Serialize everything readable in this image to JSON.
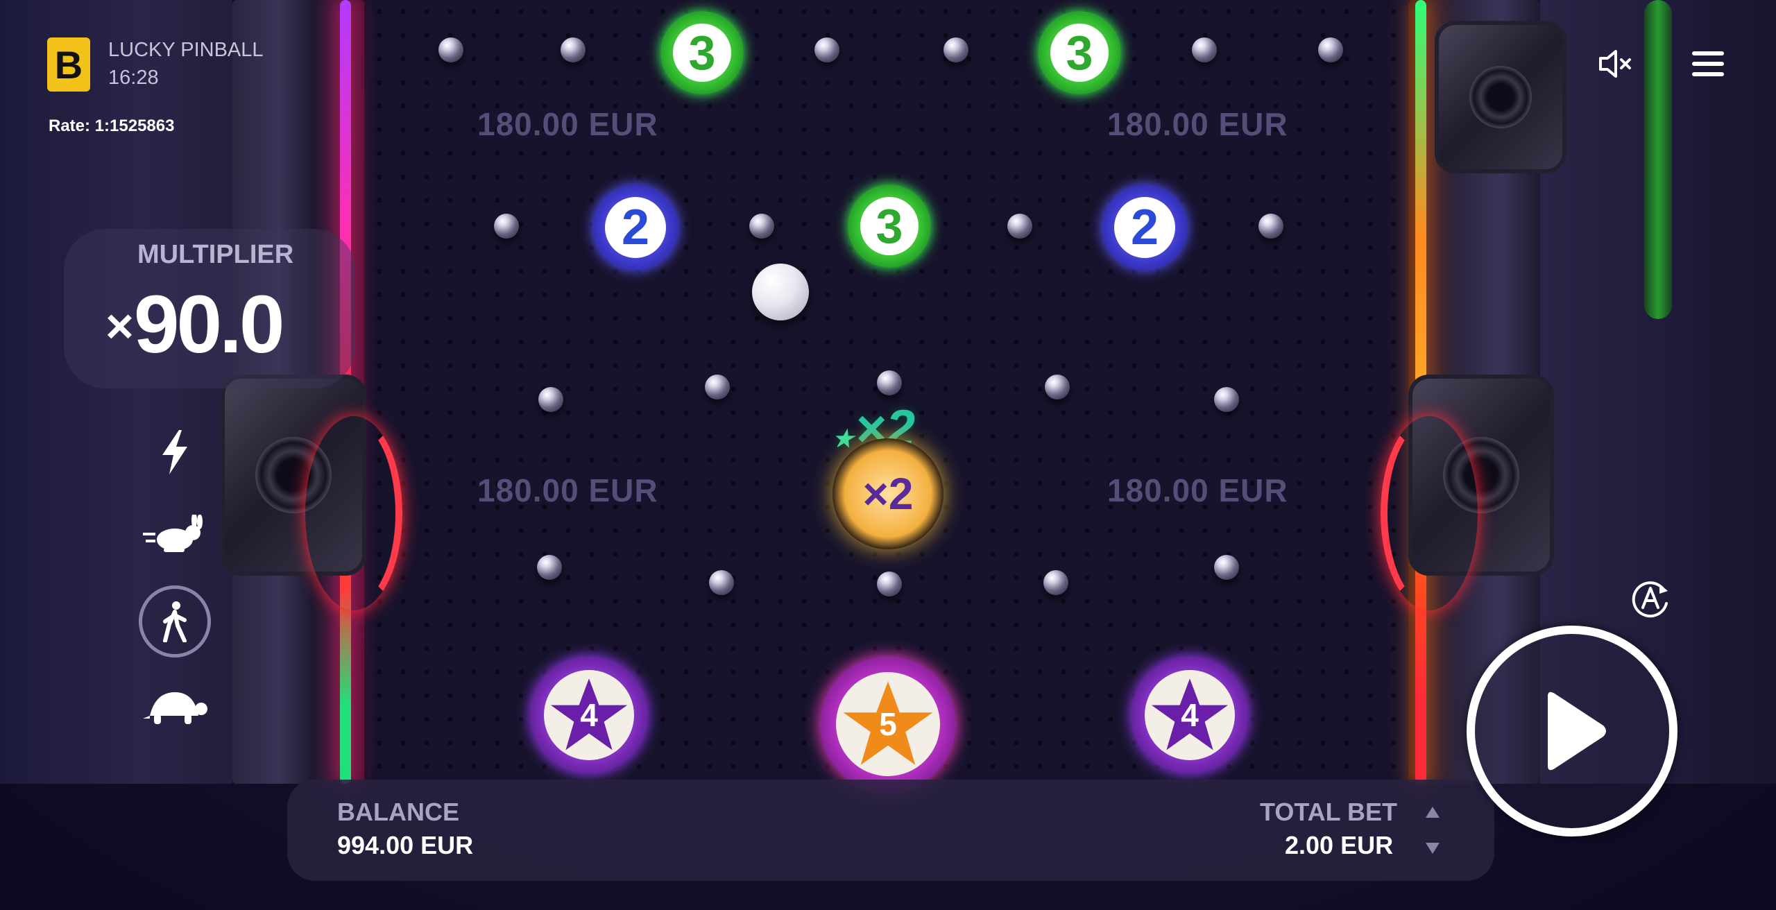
{
  "header": {
    "logo_letter": "B",
    "game_title": "LUCKY PINBALL",
    "clock": "16:28",
    "rate": "Rate: 1:1525863"
  },
  "multiplier": {
    "label": "MULTIPLIER",
    "prefix": "×",
    "value": "90.0"
  },
  "speed_controls": [
    {
      "name": "turbo",
      "icon": "lightning-icon",
      "active": false
    },
    {
      "name": "fast",
      "icon": "rabbit-icon",
      "active": false
    },
    {
      "name": "normal",
      "icon": "walking-person-icon",
      "active": true
    },
    {
      "name": "slow",
      "icon": "turtle-icon",
      "active": false
    }
  ],
  "board": {
    "prizes": [
      "180.00 EUR",
      "180.00 EUR",
      "180.00 EUR",
      "180.00 EUR"
    ],
    "tokens_row1": [
      "3",
      "3"
    ],
    "tokens_row2": [
      "2",
      "3",
      "2"
    ],
    "center_multiplier": "×2",
    "center_badge": "×2",
    "star_tokens": [
      "4",
      "5",
      "4"
    ]
  },
  "bottom_bar": {
    "balance_label": "BALANCE",
    "balance_value": "994.00 EUR",
    "total_bet_label": "TOTAL BET",
    "total_bet_value": "2.00 EUR"
  },
  "controls": {
    "sound_icon": "speaker-muted-icon",
    "menu_icon": "hamburger-menu-icon",
    "autoplay_icon": "autoplay-icon",
    "play_icon": "play-icon",
    "bet_up_icon": "triangle-up-icon",
    "bet_down_icon": "triangle-down-icon"
  },
  "colors": {
    "logo_yellow": "#f2c21b",
    "neon_left": "#ff2fb0",
    "neon_right": "#ff8a20",
    "token3_green": "#2eb82e",
    "token2_blue": "#2a4ad8",
    "star_purple": "#6a1fa8",
    "star_orange": "#f08a1a"
  }
}
